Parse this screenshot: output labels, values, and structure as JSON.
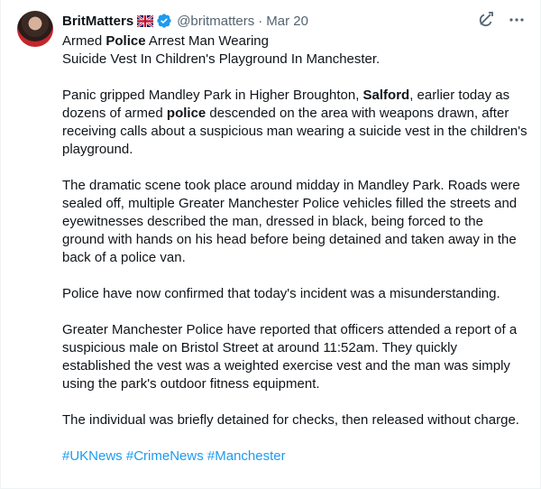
{
  "tweet": {
    "display_name": "BritMatters",
    "handle": "@britmatters",
    "separator": "·",
    "date": "Mar 20",
    "title_line1": [
      "Armed ",
      "Police",
      " Arrest Man Wearing"
    ],
    "title_line2": "Suicide Vest In Children's Playground In Manchester.",
    "para1": [
      "Panic gripped Mandley Park in Higher Broughton, ",
      "Salford",
      ", earlier today as dozens of armed ",
      "police",
      " descended on the area with weapons drawn, after receiving calls about a suspicious man wearing a suicide vest in the children's playground."
    ],
    "para2": "The dramatic scene took place around midday in Mandley Park. Roads were sealed off, multiple Greater Manchester Police vehicles filled the streets and eyewitnesses described the man, dressed in black, being forced to the ground with hands on his head before being detained and taken away in the back of a police van.",
    "para3": "Police have now confirmed that today's incident was a misunderstanding.",
    "para4": "Greater Manchester Police have reported that officers attended a report of a suspicious male on Bristol Street at around 11:52am. They quickly established the vest was a weighted exercise vest and the man was simply using the park's outdoor fitness equipment.",
    "para5": "The individual was briefly detained for checks, then released without charge.",
    "hashtags": [
      "#UKNews",
      "#CrimeNews",
      "#Manchester"
    ]
  },
  "icons": {
    "flag": "uk-flag-icon",
    "verified": "verified-badge-icon",
    "grok": "grok-icon",
    "more": "more-icon"
  },
  "colors": {
    "text": "#0f1419",
    "muted": "#536471",
    "link": "#1d9bf0",
    "verified": "#1d9bf0"
  }
}
